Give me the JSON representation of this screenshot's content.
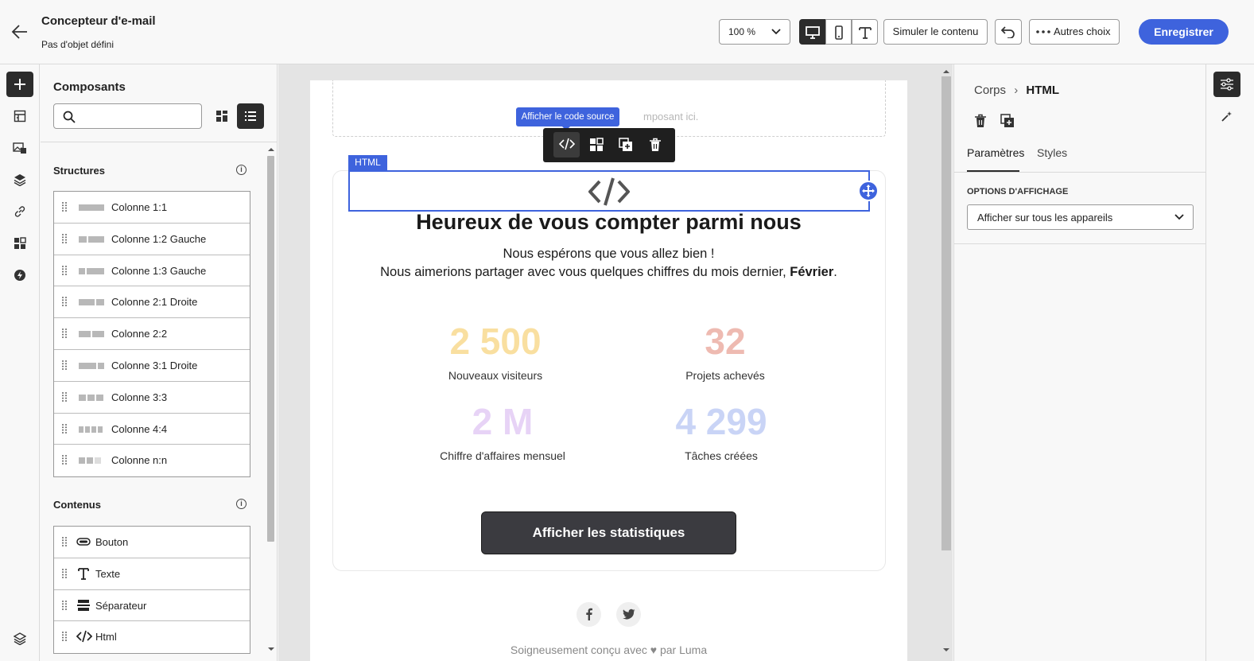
{
  "header": {
    "title": "Concepteur d'e-mail",
    "subtitle": "Pas d'objet défini",
    "zoom": "100 %",
    "simulate_label": "Simuler le contenu",
    "more_label": "Autres choix",
    "save_label": "Enregistrer"
  },
  "components": {
    "title": "Composants",
    "search_placeholder": "",
    "structures_title": "Structures",
    "structures": [
      {
        "label": "Colonne 1:1"
      },
      {
        "label": "Colonne 1:2 Gauche"
      },
      {
        "label": "Colonne 1:3 Gauche"
      },
      {
        "label": "Colonne 2:1 Droite"
      },
      {
        "label": "Colonne 2:2"
      },
      {
        "label": "Colonne 3:1 Droite"
      },
      {
        "label": "Colonne 3:3"
      },
      {
        "label": "Colonne 4:4"
      },
      {
        "label": "Colonne n:n"
      }
    ],
    "contents_title": "Contenus",
    "contents": [
      {
        "label": "Bouton",
        "icon": "button-icon"
      },
      {
        "label": "Texte",
        "icon": "text-icon"
      },
      {
        "label": "Séparateur",
        "icon": "divider-icon"
      },
      {
        "label": "Html",
        "icon": "code-icon"
      }
    ]
  },
  "canvas": {
    "dropzone_text": "mposant ici.",
    "tooltip": "Afficher le code source",
    "html_tag": "HTML",
    "headline": "Heureux de vous compter parmi nous",
    "intro_line1": "Nous espérons que vous allez bien !",
    "intro_line2": "Nous aimerions partager avec vous quelques chiffres du mois dernier, ",
    "intro_month": "Février",
    "intro_end": ".",
    "stats": [
      {
        "value": "2 500",
        "label": "Nouveaux visiteurs",
        "color": "#f9dfa0"
      },
      {
        "value": "32",
        "label": "Projets achevés",
        "color": "#eebab1"
      },
      {
        "value": "2 M",
        "label": "Chiffre d'affaires mensuel",
        "color": "#e7d3f6"
      },
      {
        "value": "4 299",
        "label": "Tâches créées",
        "color": "#c9d4f6"
      }
    ],
    "cta_label": "Afficher les statistiques",
    "footer_pre": "Soigneusement conçu avec",
    "footer_post": "par Luma"
  },
  "properties": {
    "breadcrumb_parent": "Corps",
    "breadcrumb_current": "HTML",
    "tab_params": "Paramètres",
    "tab_styles": "Styles",
    "display_options_label": "OPTIONS D'AFFICHAGE",
    "display_value": "Afficher sur tous les appareils"
  },
  "colors": {
    "accent": "#3e63dd",
    "dark": "#2c2c2c"
  }
}
